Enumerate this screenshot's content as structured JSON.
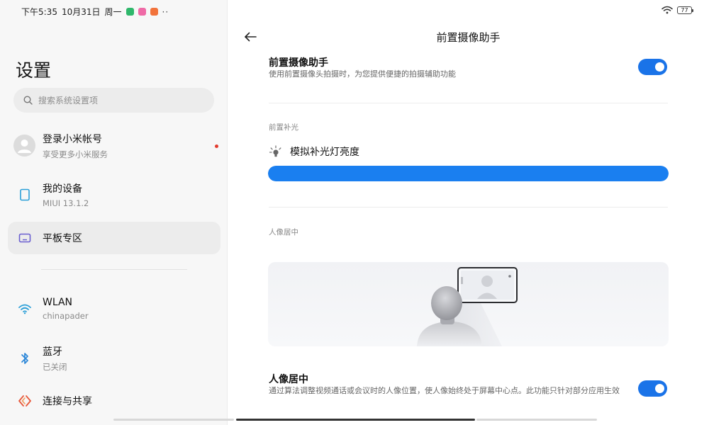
{
  "status_bar": {
    "time": "下午5:35",
    "date": "10月31日",
    "weekday": "周一",
    "notification_icons": [
      {
        "name": "app-green-icon",
        "color": "#2fb76b"
      },
      {
        "name": "app-pink-icon",
        "color": "#ef6aa6"
      },
      {
        "name": "app-orange-icon",
        "color": "#f2733b"
      }
    ],
    "more": "··",
    "battery_level": "77"
  },
  "sidebar": {
    "title": "设置",
    "search_placeholder": "搜索系统设置项",
    "account": {
      "label": "登录小米帐号",
      "sub": "享受更多小米服务"
    },
    "items": [
      {
        "label": "我的设备",
        "sub": "MIUI 13.1.2",
        "icon": "tablet-icon",
        "color": "#2a9fd8"
      },
      {
        "label": "平板专区",
        "sub": "",
        "icon": "tablet-zone-icon",
        "color": "#6a5fd0"
      },
      {
        "label": "WLAN",
        "sub": "chinapader",
        "icon": "wifi-icon",
        "color": "#2a9fd8"
      },
      {
        "label": "蓝牙",
        "sub": "已关闭",
        "icon": "bluetooth-icon",
        "color": "#2a86d8"
      },
      {
        "label": "连接与共享",
        "sub": "",
        "icon": "share-icon",
        "color": "#e8573a"
      }
    ],
    "active_index": 1
  },
  "detail": {
    "page_title": "前置摄像助手",
    "main_toggle": {
      "title": "前置摄像助手",
      "desc": "使用前置摄像头拍摄时，为您提供便捷的拍摄辅助功能",
      "on": true
    },
    "fill_light_section": "前置补光",
    "fill_light": {
      "label": "模拟补光灯亮度",
      "value_fraction": 1.0
    },
    "portrait_section": "人像居中",
    "portrait_toggle": {
      "title": "人像居中",
      "desc": "通过算法调整视频通话或会议时的人像位置，使人像始终处于屏幕中心点。此功能只针对部分应用生效",
      "on": true
    }
  },
  "colors": {
    "accent": "#1a73e8",
    "slider": "#1a7ff0",
    "notice_dot": "#e23b2e"
  }
}
